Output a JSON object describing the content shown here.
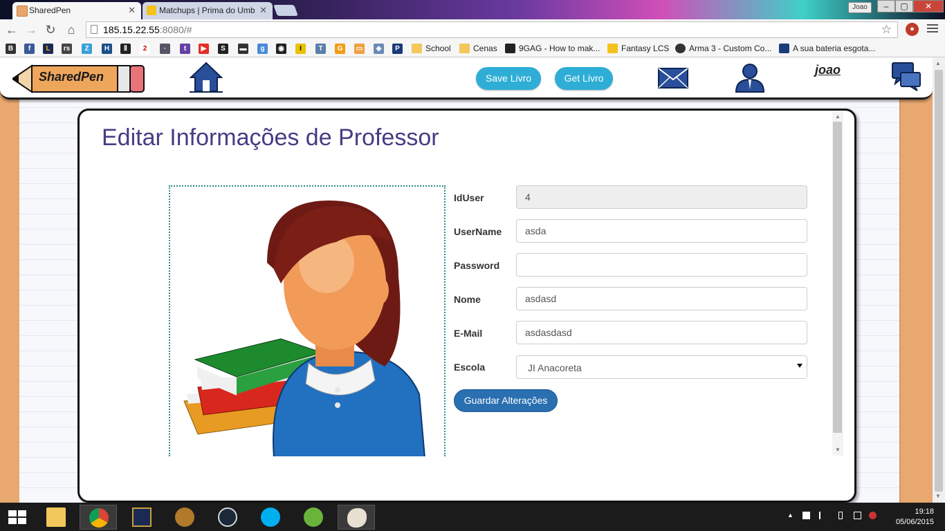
{
  "browser": {
    "tabs": [
      {
        "title": "SharedPen",
        "active": true
      },
      {
        "title": "Matchups | Prima do Umb",
        "active": false
      }
    ],
    "user_badge": "Joao",
    "window_controls": {
      "minimize": "–",
      "maximize": "▢",
      "close": "✕"
    },
    "url": {
      "host": "185.15.22.55",
      "rest": ":8080/#"
    },
    "bookmarks": [
      {
        "label": "School",
        "icon": "folder-icon"
      },
      {
        "label": "Cenas",
        "icon": "folder-icon"
      },
      {
        "label": "9GAG - How to mak...",
        "icon": "9gag-icon"
      },
      {
        "label": "Fantasy LCS",
        "icon": "fantasy-icon"
      },
      {
        "label": "Arma 3 - Custom Co...",
        "icon": "arma-icon"
      },
      {
        "label": "A sua bateria esgota...",
        "icon": "p-icon"
      }
    ]
  },
  "navbar": {
    "logo_text": "SharedPen",
    "save_livro": "Save Livro",
    "get_livro": "Get Livro",
    "username": "joao",
    "accent": "#2eaed6"
  },
  "main": {
    "title": "Editar Informações de Professor",
    "fields": {
      "iduser": {
        "label": "IdUser",
        "value": "4"
      },
      "username": {
        "label": "UserName",
        "value": "asda"
      },
      "password": {
        "label": "Password",
        "value": ""
      },
      "nome": {
        "label": "Nome",
        "value": "asdasd"
      },
      "email": {
        "label": "E-Mail",
        "value": "asdasdasd"
      },
      "escola": {
        "label": "Escola",
        "value": "JI Anacoreta"
      }
    },
    "save_button": "Guardar Alterações",
    "title_color": "#463c84"
  },
  "taskbar": {
    "time": "19:18",
    "date": "05/06/2015"
  }
}
